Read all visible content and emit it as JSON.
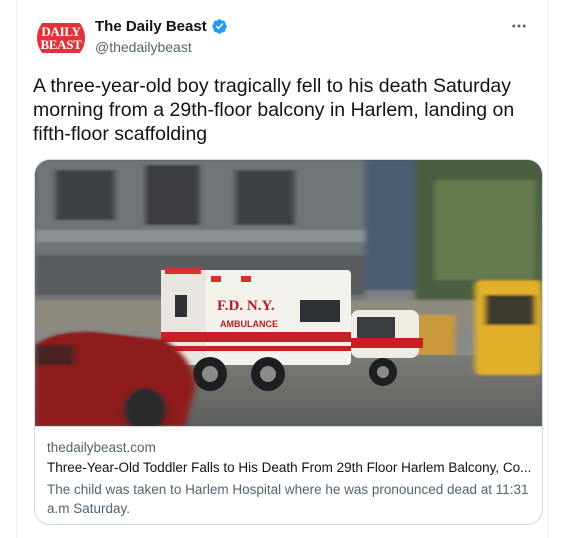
{
  "tweet": {
    "author": {
      "name": "The Daily Beast",
      "handle": "@thedailybeast",
      "avatar_logo": [
        "DAILY",
        "BEAST"
      ],
      "verified": true,
      "verified_color": "#1d9bf0"
    },
    "more_icon": "more-horizontal-icon",
    "text": "A three-year-old boy tragically fell to his death Saturday morning from a 29th-floor balcony in Harlem, landing on fifth-floor scaffolding"
  },
  "link_card": {
    "image": {
      "ambulance_text": "F.D.  N.Y.",
      "ambulance_label": "AMBULANCE"
    },
    "domain": "thedailybeast.com",
    "title": "Three-Year-Old Toddler Falls to His Death From 29th Floor Harlem Balcony, Co...",
    "description": "The child was taken to Harlem Hospital where he was pronounced dead at 11:31 a.m Saturday."
  },
  "colors": {
    "text_primary": "#0f1419",
    "text_secondary": "#536471",
    "border": "#cfd9de",
    "brand_red": "#e23237"
  }
}
